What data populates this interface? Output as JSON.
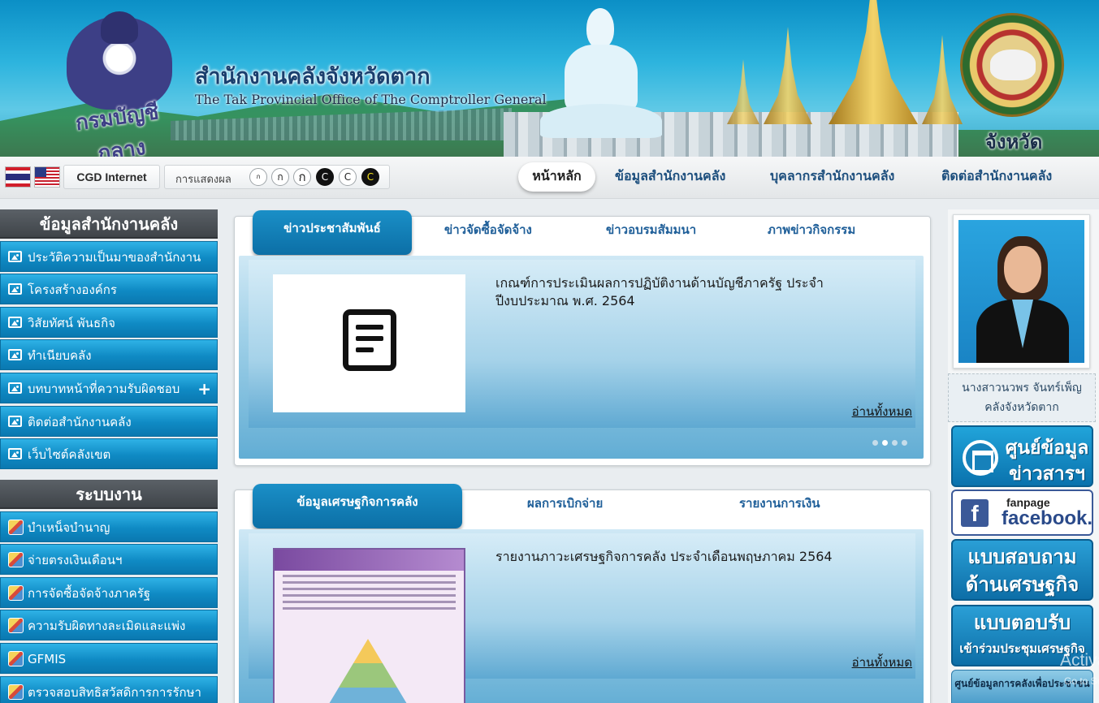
{
  "header": {
    "logo_text": "กรมบัญชีกลาง",
    "title_th": "สำนักงานคลังจังหวัดตาก",
    "title_en": "The Tak Provincial Office of The Comptroller General",
    "province_label": "จังหวัดตาก"
  },
  "toolbar": {
    "cgd_internet": "CGD Internet",
    "display_label": "การแสดงผล",
    "font_buttons": [
      "ก",
      "ก",
      "ก",
      "C",
      "C",
      "C"
    ],
    "nav": [
      "หน้าหลัก",
      "ข้อมูลสำนักงานคลัง",
      "บุคลากรสำนักงานคลัง",
      "ติดต่อสำนักงานคลัง"
    ]
  },
  "sidebar": {
    "section1_title": "ข้อมูลสำนักงานคลัง",
    "section1_items": [
      "ประวัติความเป็นมาของสำนักงาน",
      "โครงสร้างองค์กร",
      "วิสัยทัศน์ พันธกิจ",
      "ทำเนียบคลัง",
      "บทบาทหน้าที่ความรับผิดชอบ",
      "ติดต่อสำนักงานคลัง",
      "เว็บไซต์คลังเขต"
    ],
    "expand_symbol": "+",
    "section2_title": "ระบบงาน",
    "section2_items": [
      "บำเหน็จบำนาญ",
      "จ่ายตรงเงินเดือนฯ",
      "การจัดซื้อจัดจ้างภาครัฐ",
      "ความรับผิดทางละเมิดและแพ่ง",
      "GFMIS",
      "ตรวจสอบสิทธิสวัสดิการการรักษา"
    ]
  },
  "news_panel": {
    "tabs": [
      "ข่าวประชาสัมพันธ์",
      "ข่าวจัดซื้อจัดจ้าง",
      "ข่าวอบรมสัมมนา",
      "ภาพข่าวกิจกรรม"
    ],
    "item_title": "เกณฑ์การประเมินผลการปฏิบัติงานด้านบัญชีภาครัฐ ประจำปีงบประมาณ พ.ศ. 2564",
    "read_all": "อ่านทั้งหมด"
  },
  "econ_panel": {
    "tabs": [
      "ข้อมูลเศรษฐกิจการคลัง",
      "ผลการเบิกจ่าย",
      "รายงานการเงิน"
    ],
    "item_title": "รายงานภาวะเศรษฐกิจการคลัง ประจำเดือนพฤษภาคม 2564",
    "read_all": "อ่านทั้งหมด"
  },
  "right": {
    "person_name": "นางสาวนวพร จันทร์เพ็ญ",
    "person_title": "คลังจังหวัดตาก",
    "info_center_1": "ศูนย์ข้อมูล",
    "info_center_2": "ข่าวสารฯ",
    "fb_small": "fanpage",
    "fb_big": "facebook.",
    "fb_icon": "f",
    "survey_1": "แบบสอบถาม",
    "survey_2": "ด้านเศรษฐกิจ",
    "reply_1": "แบบตอบรับ",
    "reply_2": "เข้าร่วมประชุมเศรษฐกิจ",
    "center_btn": "ศูนย์ข้อมูลการคลังเพื่อประชาชน"
  },
  "overlay": {
    "line1": "Activat",
    "line2": "Go to Se"
  }
}
